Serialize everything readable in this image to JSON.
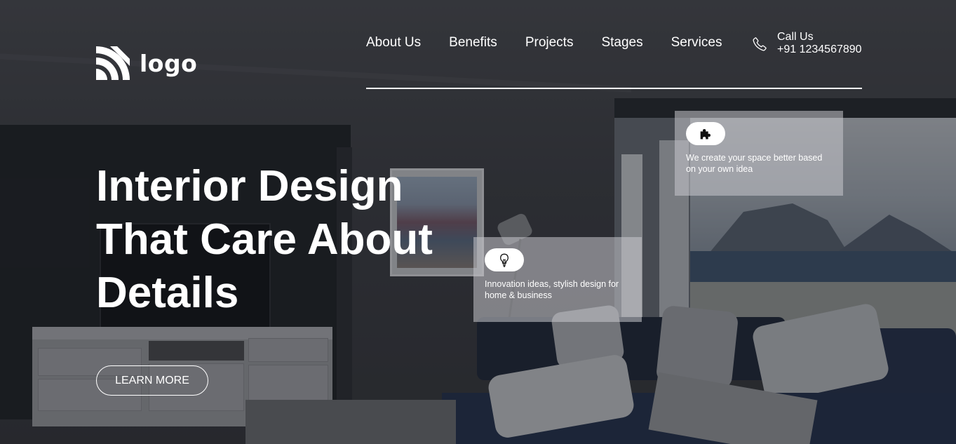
{
  "header": {
    "logo_text": "logo",
    "logo_icon": "wifi-signal-logo-icon",
    "nav": [
      {
        "label": "About Us"
      },
      {
        "label": "Benefits"
      },
      {
        "label": "Projects"
      },
      {
        "label": "Stages"
      },
      {
        "label": "Services"
      }
    ],
    "call": {
      "icon": "phone-icon",
      "label": "Call Us",
      "number": "+91 1234567890"
    }
  },
  "hero": {
    "headline_lines": [
      "Interior Design",
      "That Care About",
      "Details"
    ],
    "cta_label": "LEARN MORE"
  },
  "features": [
    {
      "icon": "puzzle-icon",
      "text": "We create your space better based on your own idea"
    },
    {
      "icon": "lightbulb-icon",
      "text": "Innovation ideas, stylish design for home & business"
    }
  ],
  "colors": {
    "text": "#ffffff",
    "card_background": "#c8c9cd",
    "overlay": "#16171c"
  }
}
